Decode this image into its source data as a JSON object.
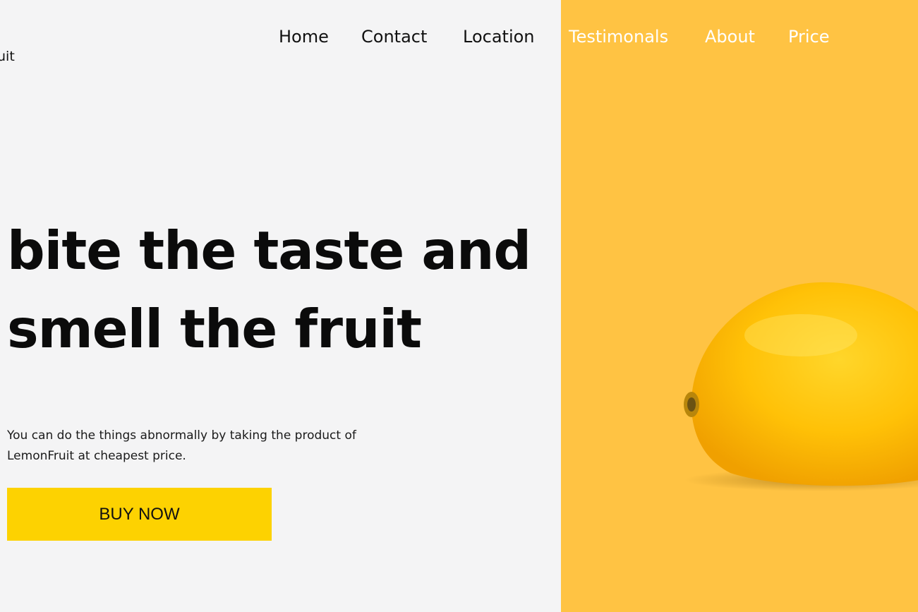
{
  "colors": {
    "page_background": "#f4f4f5",
    "panel_accent": "#ffc343",
    "button_background": "#fdd201",
    "nav_text_dark": "#111111",
    "nav_text_light": "#ffffff",
    "lemon": "#ffc107"
  },
  "brand": {
    "logo_fragment": "uit"
  },
  "nav": {
    "items": [
      {
        "label": "Home"
      },
      {
        "label": "Contact"
      },
      {
        "label": "Location"
      },
      {
        "label": "Testimonals"
      },
      {
        "label": "About"
      },
      {
        "label": "Price"
      }
    ]
  },
  "hero": {
    "title_line1": "bite the taste and",
    "title_line2": "smell the fruit",
    "description": "You can do the things abnormally by taking the product of LemonFruit at cheapest price.",
    "cta_label": "BUY NOW"
  },
  "image": {
    "icon": "lemon-icon"
  }
}
